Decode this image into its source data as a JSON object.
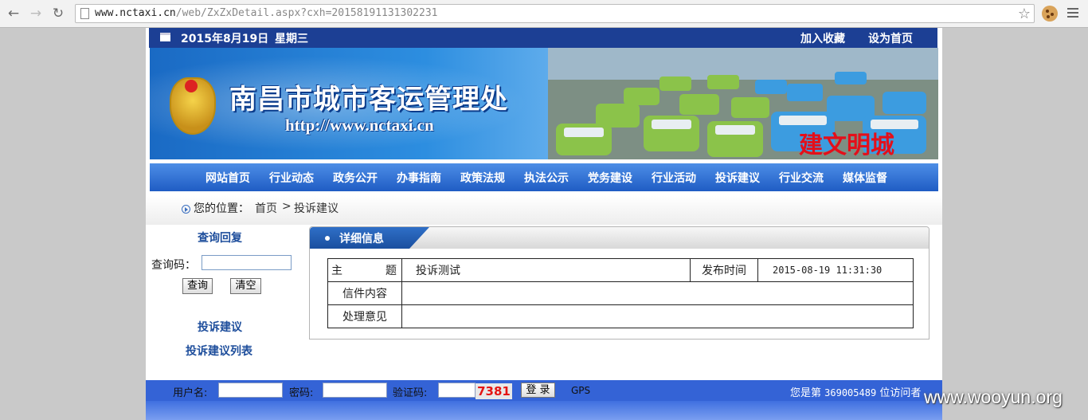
{
  "browser": {
    "url_host": "www.nctaxi.cn",
    "url_path": "/web/ZxZxDetail.aspx?cxh=20158191131302231"
  },
  "topbar": {
    "date": "2015年8月19日",
    "weekday": "星期三",
    "favorite": "加入收藏",
    "set_home": "设为首页"
  },
  "banner": {
    "site_name": "南昌市城市客运管理处",
    "site_url": "http://www.nctaxi.cn",
    "slogan": "建文明城"
  },
  "nav": [
    "网站首页",
    "行业动态",
    "政务公开",
    "办事指南",
    "政策法规",
    "执法公示",
    "党务建设",
    "行业活动",
    "投诉建议",
    "行业交流",
    "媒体监督"
  ],
  "breadcrumb": {
    "label": "您的位置：",
    "home": "首页",
    "separator": ">",
    "current": "投诉建议"
  },
  "left": {
    "query_title": "查询回复",
    "query_label": "查询码：",
    "query_value": "",
    "search_btn": "查询",
    "clear_btn": "清空",
    "link1": "投诉建议",
    "link2": "投诉建议列表"
  },
  "detail": {
    "title": "详细信息",
    "subject_label_a": "主",
    "subject_label_b": "题",
    "subject": "投诉测试",
    "time_label": "发布时间",
    "time": "2015-08-19 11:31:30",
    "content_label": "信件内容",
    "content": "",
    "reply_label": "处理意见",
    "reply": ""
  },
  "footer": {
    "username_label": "用户名:",
    "password_label": "密码:",
    "captcha_label": "验证码:",
    "captcha_code": "7381",
    "login_btn": "登 录",
    "gps": "GPS",
    "visitor_prefix": "您是第",
    "visitor_count": "369005489",
    "visitor_suffix": "位访问者"
  },
  "watermark": "www.wooyun.org",
  "colors": {
    "nav_blue": "#1f5cc4",
    "header_dark": "#1c3f94",
    "slogan_red": "#e40f1a"
  }
}
